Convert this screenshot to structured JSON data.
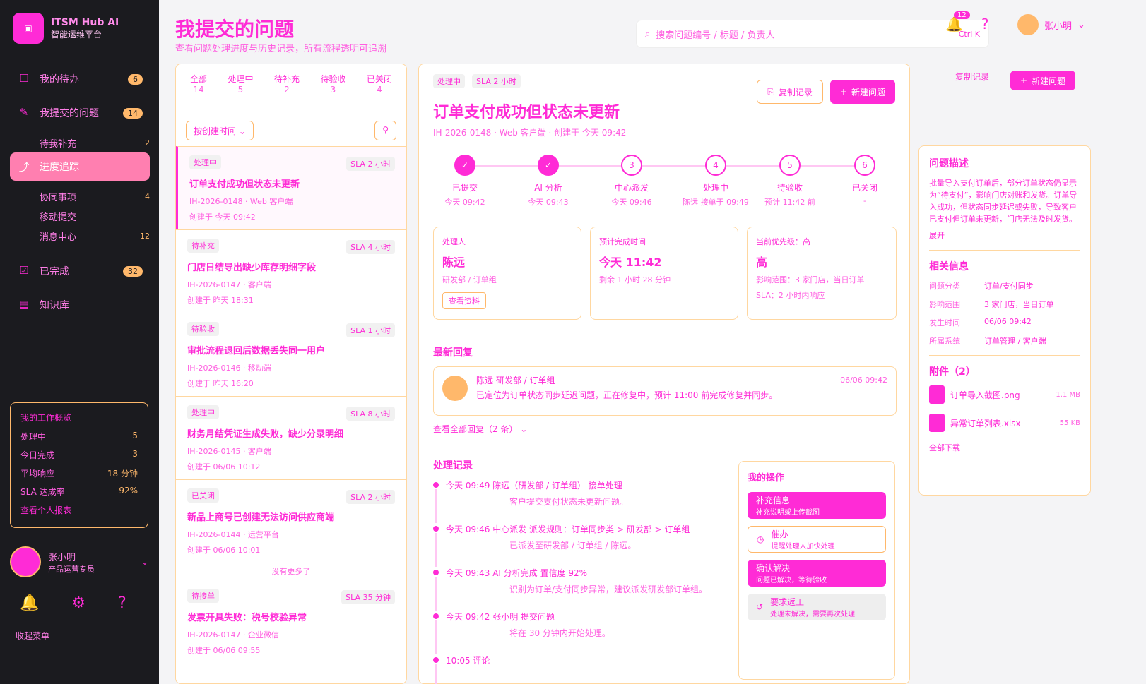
{
  "app": {
    "name": "ITSM Hub AI",
    "subtitle": "智能运维平台"
  },
  "sidebar": {
    "items": [
      {
        "label": "我的待办",
        "icon": "inbox-icon",
        "count": "6"
      },
      {
        "label": "我提交的问题",
        "icon": "submit-icon",
        "count": "14"
      }
    ],
    "subitems": [
      {
        "label": "待我补充",
        "count": "2"
      },
      {
        "label": "进度追踪",
        "count": ""
      },
      {
        "label": "协同事项",
        "count": "4"
      },
      {
        "label": "移动提交",
        "count": ""
      },
      {
        "label": "消息中心",
        "count": "12"
      }
    ],
    "items2": [
      {
        "label": "已完成",
        "icon": "check-icon",
        "count": "32"
      },
      {
        "label": "知识库",
        "icon": "book-icon",
        "count": ""
      }
    ],
    "stats": {
      "title": "我的工作概览",
      "rows": [
        {
          "k": "处理中",
          "v": "5"
        },
        {
          "k": "今日完成",
          "v": "3"
        },
        {
          "k": "平均响应",
          "v": "18 分钟"
        },
        {
          "k": "SLA 达成率",
          "v": "92%"
        }
      ],
      "link": "查看个人报表"
    },
    "user": {
      "name": "张小明",
      "role": "产品运营专员"
    },
    "collapse": "收起菜单"
  },
  "header": {
    "title": "我提交的问题",
    "subtitle": "查看问题处理进度与历史记录，所有流程透明可追溯",
    "search_placeholder": "搜索问题编号 / 标题 / 负责人",
    "search_kbd": "Ctrl K",
    "notif_count": "12",
    "user_name": "张小明"
  },
  "list": {
    "tabs": [
      {
        "label": "全部",
        "count": "14"
      },
      {
        "label": "处理中",
        "count": "5"
      },
      {
        "label": "待补充",
        "count": "2"
      },
      {
        "label": "待验收",
        "count": "3"
      },
      {
        "label": "已关闭",
        "count": "4"
      }
    ],
    "filter_label": "按创建时间",
    "cards": [
      {
        "status": "处理中",
        "sla": "SLA 2 小时",
        "title": "订单支付成功但状态未更新",
        "meta": "IH-2026-0148 · Web 客户端",
        "date": "创建于 今天 09:42"
      },
      {
        "status": "待补充",
        "sla": "SLA 4 小时",
        "title": "门店日结导出缺少库存明细字段",
        "meta": "IH-2026-0147 · 客户端",
        "date": "创建于 昨天 18:31"
      },
      {
        "status": "待验收",
        "sla": "SLA 1 小时",
        "title": "审批流程退回后数据丢失同一用户",
        "meta": "IH-2026-0146 · 移动端",
        "date": "创建于 昨天 16:20"
      },
      {
        "status": "处理中",
        "sla": "SLA 8 小时",
        "title": "财务月结凭证生成失败，缺少分录明细",
        "meta": "IH-2026-0145 · 客户端",
        "date": "创建于 06/06 10:12"
      },
      {
        "status": "已关闭",
        "sla": "SLA 2 小时",
        "title": "新品上商号已创建无法访问供应商端",
        "meta": "IH-2026-0144 · 运营平台",
        "date": "创建于 06/06 10:01"
      },
      {
        "status": "待接单",
        "sla": "SLA 35 分钟",
        "title": "发票开具失败：税号校验异常",
        "meta": "IH-2026-0147 · 企业微信",
        "date": "创建于 06/06 09:55"
      }
    ],
    "no_more": "没有更多了"
  },
  "detail": {
    "status": "处理中",
    "sla": "SLA 2 小时",
    "title": "订单支付成功但状态未更新",
    "meta": "IH-2026-0148 · Web 客户端 · 创建于 今天 09:42",
    "copy_btn": "复制记录",
    "new_btn": "新建问题",
    "steps": [
      {
        "label": "已提交",
        "time": "今天 09:42",
        "mark": "✓",
        "done": true
      },
      {
        "label": "AI 分析",
        "time": "今天 09:43",
        "mark": "✓",
        "done": true
      },
      {
        "label": "中心派发",
        "time": "今天 09:46",
        "mark": "3",
        "done": false
      },
      {
        "label": "处理中",
        "time": "陈远 接单于 09:49",
        "mark": "4",
        "done": false
      },
      {
        "label": "待验收",
        "time": "预计 11:42 前",
        "mark": "5",
        "done": false
      },
      {
        "label": "已关闭",
        "time": "-",
        "mark": "6",
        "done": false
      }
    ],
    "handler": {
      "k": "处理人",
      "name": "陈远",
      "dept": "研发部 / 订单组",
      "link": "查看资料"
    },
    "eta": {
      "k": "预计完成时间",
      "v": "今天 11:42",
      "s": "剩余 1 小时 28 分钟"
    },
    "priority": {
      "k": "当前优先级：高",
      "v": "高",
      "s1": "影响范围：3 家门店，当日订单",
      "s2": "SLA：2 小时内响应"
    },
    "reply_title": "最新回复",
    "reply": {
      "who": "陈远 研发部 / 订单组",
      "txt": "已定位为订单状态同步延迟问题，正在修复中，预计 11:00 前完成修复并同步。",
      "time": "06/06 09:42"
    },
    "view_all": "查看全部回复（2 条）",
    "log_title": "处理记录",
    "logs": [
      {
        "h": "今天 09:49  陈远（研发部 / 订单组） 接单处理",
        "b": "客户提交支付状态未更新问题。"
      },
      {
        "h": "今天 09:46  中心派发  派发规则：订单同步类 > 研发部 > 订单组",
        "b": "已派发至研发部 / 订单组 / 陈远。"
      },
      {
        "h": "今天 09:43  AI 分析完成  置信度 92%",
        "b": "识别为订单/支付同步异常，建议派发研发部订单组。"
      },
      {
        "h": "今天 09:42  张小明  提交问题",
        "b": "将在 30 分钟内开始处理。"
      },
      {
        "h": "10:05  评论",
        "b": ""
      }
    ],
    "ops_title": "我的操作",
    "ops": [
      {
        "label": "补充信息",
        "sub": "补充说明或上传截图",
        "style": "p"
      },
      {
        "label": "催办",
        "sub": "提醒处理人加快处理",
        "style": "o"
      },
      {
        "label": "确认解决",
        "sub": "问题已解决，等待验收",
        "style": "p"
      },
      {
        "label": "要求返工",
        "sub": "处理未解决，需要再次处理",
        "style": "g"
      }
    ]
  },
  "right": {
    "desc_title": "问题描述",
    "desc": "批量导入支付订单后，部分订单状态仍显示为“待支付”，影响门店对账和发货。订单导入成功，但状态同步延迟或失败，导致客户已支付但订单未更新，门店无法及时发货。",
    "expand": "展开",
    "info_title": "相关信息",
    "info": [
      {
        "k": "问题分类",
        "v": "订单/支付同步"
      },
      {
        "k": "影响范围",
        "v": "3 家门店，当日订单"
      },
      {
        "k": "发生时间",
        "v": "06/06 09:42"
      },
      {
        "k": "所属系统",
        "v": "订单管理 / 客户端"
      }
    ],
    "att_title": "附件（2）",
    "attachments": [
      {
        "name": "订单导入截图.png",
        "size": "1.1 MB"
      },
      {
        "name": "异常订单列表.xlsx",
        "size": "55 KB"
      }
    ],
    "download_all": "全部下载"
  }
}
